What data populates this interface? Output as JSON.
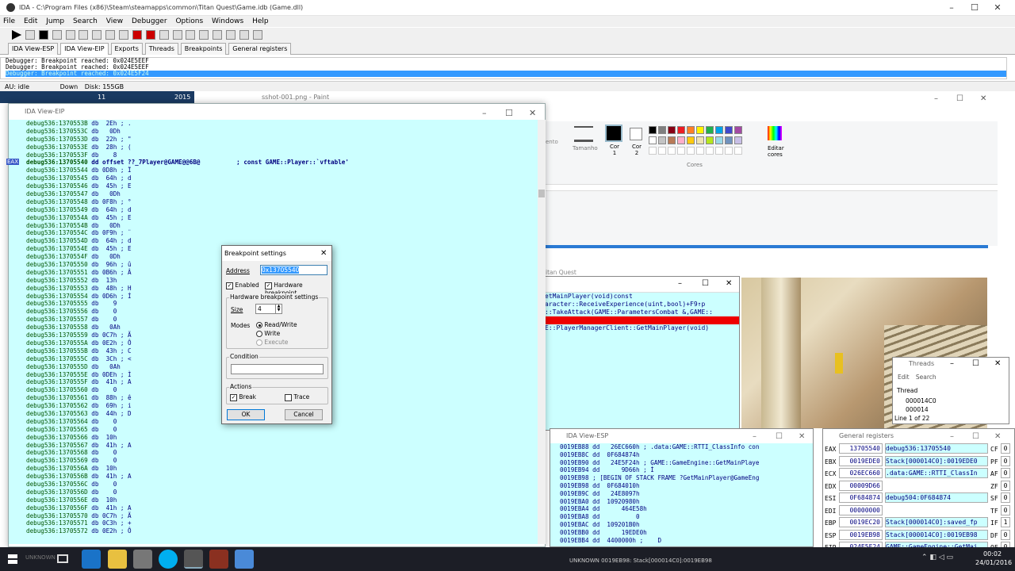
{
  "ida": {
    "title": "IDA - C:\\Program Files (x86)\\Steam\\steamapps\\common\\Titan Quest\\Game.idb (Game.dll)",
    "menu": [
      "File",
      "Edit",
      "Jump",
      "Search",
      "View",
      "Debugger",
      "Options",
      "Windows",
      "Help"
    ],
    "tabs": [
      "IDA View-ESP",
      "IDA View-EIP",
      "Exports",
      "Threads",
      "Breakpoints",
      "General registers"
    ],
    "output": [
      "Debugger: Breakpoint reached: 0x024E5EEF",
      "Debugger: Breakpoint reached: 0x024E5EEF",
      "Debugger: Breakpoint reached: 0x024E5F24"
    ],
    "status": {
      "au": "AU: idle",
      "dir": "Down",
      "disk": "Disk: 155GB"
    }
  },
  "underlay": {
    "num1": "11",
    "num2": "2015",
    "paint_title": "sshot-001.png - Paint"
  },
  "eip_view": {
    "title": "IDA View-EIP",
    "eax_marker": "EAX",
    "lines": [
      "debug536:1370553B db  2Eh ; .",
      "debug536:1370553C db   0Dh",
      "debug536:1370553D db  22h ; \"",
      "debug536:1370553E db  28h ; (",
      "debug536:1370553F db    8",
      "debug536:13705540 dd offset ??_7Player@GAME@@6B@          ; const GAME::Player::`vftable'",
      "debug536:13705544 db 0D8h ; Ï",
      "debug536:13705545 db  64h ; d",
      "debug536:13705546 db  45h ; E",
      "debug536:13705547 db   0Dh",
      "debug536:13705548 db 0F8h ; °",
      "debug536:13705549 db  64h ; d",
      "debug536:1370554A db  45h ; E",
      "debug536:1370554B db   0Dh",
      "debug536:1370554C db 0F9h ; ¨",
      "debug536:1370554D db  64h ; d",
      "debug536:1370554E db  45h ; E",
      "debug536:1370554F db   0Dh",
      "debug536:13705550 db  96h ; û",
      "debug536:13705551 db 0B6h ; Â",
      "debug536:13705552 db  13h",
      "debug536:13705553 db  48h ; H",
      "debug536:13705554 db 0D6h ; Í",
      "debug536:13705555 db    9",
      "debug536:13705556 db    0",
      "debug536:13705557 db    0",
      "debug536:13705558 db   0Ah",
      "debug536:13705559 db 0C7h ; Ã",
      "debug536:1370555A db 0E2h ; Ô",
      "debug536:1370555B db  43h ; C",
      "debug536:1370555C db  3Ch ; <",
      "debug536:1370555D db   0Ah",
      "debug536:1370555E db 0DEh ; Ì",
      "debug536:1370555F db  41h ; A",
      "debug536:13705560 db    0",
      "debug536:13705561 db  88h ; ê",
      "debug536:13705562 db  69h ; i",
      "debug536:13705563 db  44h ; D",
      "debug536:13705564 db    0",
      "debug536:13705565 db    0",
      "debug536:13705566 db  10h",
      "debug536:13705567 db  41h ; A",
      "debug536:13705568 db    0",
      "debug536:13705569 db    0",
      "debug536:1370556A db  10h",
      "debug536:1370556B db  41h ; A",
      "debug536:1370556C db    0",
      "debug536:1370556D db    0",
      "debug536:1370556E db  10h",
      "debug536:1370556F db  41h ; A",
      "debug536:13705570 db 0C7h ; Ã",
      "debug536:13705571 db 0C3h ; +",
      "debug536:13705572 db 0E2h ; Ô"
    ]
  },
  "dialog": {
    "title": "Breakpoint settings",
    "address_label": "Address",
    "address_value": "0x13705540",
    "enabled": "Enabled",
    "hw": "Hardware breakpoint",
    "hw_group": "Hardware breakpoint settings",
    "size_label": "Size",
    "size_value": "4",
    "modes_label": "Modes",
    "mode_rw": "Read/Write",
    "mode_w": "Write",
    "mode_x": "Execute",
    "condition": "Condition",
    "actions": "Actions",
    "break": "Break",
    "trace": "Trace",
    "ok": "OK",
    "cancel": "Cancel"
  },
  "paint": {
    "tamanho": "Tamanho",
    "cor1": "Cor 1",
    "cor2": "Cor 2",
    "cores": "Cores",
    "editar": "Editar cores",
    "mento": "ento"
  },
  "palette": [
    "#000000",
    "#7f7f7f",
    "#880015",
    "#ed1c24",
    "#ff7f27",
    "#fff200",
    "#22b14c",
    "#00a2e8",
    "#3f48cc",
    "#a349a4",
    "#ffffff",
    "#c3c3c3",
    "#b97a57",
    "#ffaec9",
    "#ffc90e",
    "#efe4b0",
    "#b5e61d",
    "#99d9ea",
    "#7092be",
    "#c8bfe7"
  ],
  "code_window": {
    "titan": "itan Quest",
    "lines": [
      "etMainPlayer(void)const",
      "",
      "",
      "aracter::ReceiveExperience(uint,bool)+F9↑p",
      "::TakeAttack(GAME::ParametersCombat &,GAME::",
      "",
      "",
      "",
      "",
      "",
      "",
      "E::PlayerManagerClient::GetMainPlayer(void)"
    ]
  },
  "threads": {
    "title": "Threads",
    "menu": [
      "Edit",
      "Search"
    ],
    "header": "Thread",
    "rows": [
      "000014C0",
      "000014"
    ],
    "footer": "Line 1 of 22"
  },
  "esp_view": {
    "title": "IDA View-ESP",
    "lines": [
      "0019EB88 dd   26EC660h ; .data:GAME::RTTI_ClassInfo con",
      "0019EB8C dd  0F684874h",
      "0019EB90 dd   24E5F24h ; GAME::GameEngine::GetMainPlaye",
      "0019EB94 dd      9D66h ; Í",
      "0019EB98 ; [BEGIN OF STACK FRAME ?GetMainPlayer@GameEng",
      "0019EB98 dd  0F684010h",
      "0019EB9C dd   24E8097h",
      "0019EBA0 dd  10920980h",
      "0019EBA4 dd      464E58h",
      "0019EBA8 dd          0",
      "0019EBAC dd  109201B0h",
      "0019EBB0 dd      19EDE0h",
      "0019EBB4 dd  4400000h ;    D"
    ],
    "status": "UNKNOWN 0019EB98: Stack[000014C0]:0019EB98"
  },
  "registers": {
    "title": "General registers",
    "rows": [
      {
        "n": "EAX",
        "v": "13705540",
        "d": "debug536:13705540",
        "f": "CF",
        "fv": "0"
      },
      {
        "n": "EBX",
        "v": "0019EDE0",
        "d": "Stack[000014C0]:0019EDE0",
        "f": "PF",
        "fv": "0"
      },
      {
        "n": "ECX",
        "v": "026EC660",
        "d": ".data:GAME::RTTI_ClassIn",
        "f": "AF",
        "fv": "0"
      },
      {
        "n": "EDX",
        "v": "00009D66",
        "d": "",
        "f": "ZF",
        "fv": "0"
      },
      {
        "n": "ESI",
        "v": "0F684874",
        "d": "debug504:0F684874",
        "f": "SF",
        "fv": "0"
      },
      {
        "n": "EDI",
        "v": "00000000",
        "d": "",
        "f": "TF",
        "fv": "0"
      },
      {
        "n": "EBP",
        "v": "0019EC20",
        "d": "Stack[000014C0]:saved_fp",
        "f": "IF",
        "fv": "1"
      },
      {
        "n": "ESP",
        "v": "0019EB98",
        "d": "Stack[000014C0]:0019EB98",
        "f": "DF",
        "fv": "0"
      },
      {
        "n": "EIP",
        "v": "024E5F24",
        "d": "GAME::GameEngine::GetMai",
        "f": "OF",
        "fv": "0"
      },
      {
        "n": "EFL",
        "v": "00000202",
        "d": "",
        "f": "",
        "fv": ""
      }
    ]
  },
  "taskbar": {
    "time": "00:02",
    "date": "24/01/2016",
    "lang": "POR",
    "unknown": "UNKNOWN"
  }
}
